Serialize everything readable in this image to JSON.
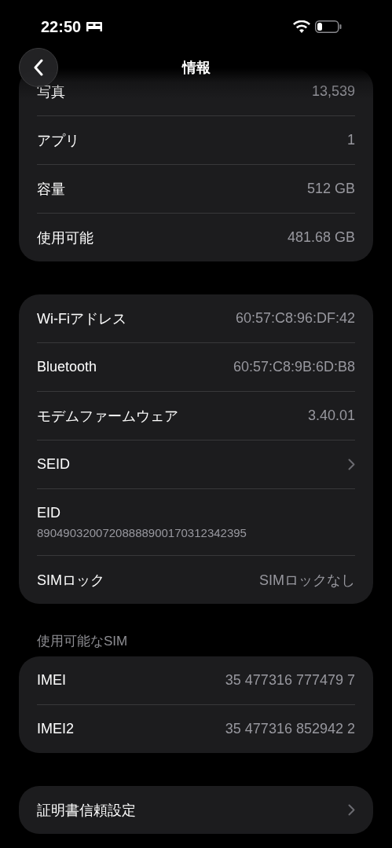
{
  "status_bar": {
    "time": "22:50"
  },
  "nav": {
    "title": "情報"
  },
  "groups": [
    {
      "rows": [
        {
          "kind": "value",
          "label": "写真",
          "value": "13,539"
        },
        {
          "kind": "value",
          "label": "アプリ",
          "value": "1"
        },
        {
          "kind": "value",
          "label": "容量",
          "value": "512 GB"
        },
        {
          "kind": "value",
          "label": "使用可能",
          "value": "481.68 GB"
        }
      ]
    },
    {
      "rows": [
        {
          "kind": "value",
          "label": "Wi-Fiアドレス",
          "value": "60:57:C8:96:DF:42"
        },
        {
          "kind": "value",
          "label": "Bluetooth",
          "value": "60:57:C8:9B:6D:B8"
        },
        {
          "kind": "value",
          "label": "モデムファームウェア",
          "value": "3.40.01"
        },
        {
          "kind": "chevron",
          "label": "SEID"
        },
        {
          "kind": "stacked",
          "label": "EID",
          "value": "89049032007208888900170312342395"
        },
        {
          "kind": "value",
          "label": "SIMロック",
          "value": "SIMロックなし"
        }
      ]
    },
    {
      "header": "使用可能なSIM",
      "rows": [
        {
          "kind": "value",
          "label": "IMEI",
          "value": "35 477316 777479 7"
        },
        {
          "kind": "value",
          "label": "IMEI2",
          "value": "35 477316 852942 2"
        }
      ]
    },
    {
      "rows": [
        {
          "kind": "chevron",
          "label": "証明書信頼設定"
        }
      ]
    }
  ]
}
